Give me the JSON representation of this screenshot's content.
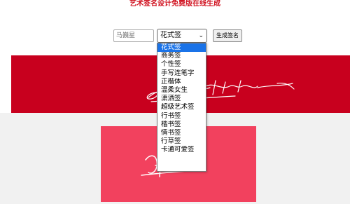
{
  "page": {
    "title": "艺术签名设计免费版在线生成"
  },
  "form": {
    "name_placeholder": "马巍星",
    "style_selected": "花式签",
    "generate_label": "生成签名"
  },
  "dropdown": {
    "options": [
      "花式签",
      "商务签",
      "个性签",
      "手写连笔字",
      "正楷体",
      "温柔女生",
      "潇洒签",
      "超级艺术签",
      "行书签",
      "楷书签",
      "情书签",
      "行草签",
      "卡通可爱签"
    ],
    "selected_index": 0
  },
  "colors": {
    "title": "#d0101e",
    "banner": "#c8001e",
    "card": "#f2415e",
    "highlight": "#1a73e8"
  }
}
